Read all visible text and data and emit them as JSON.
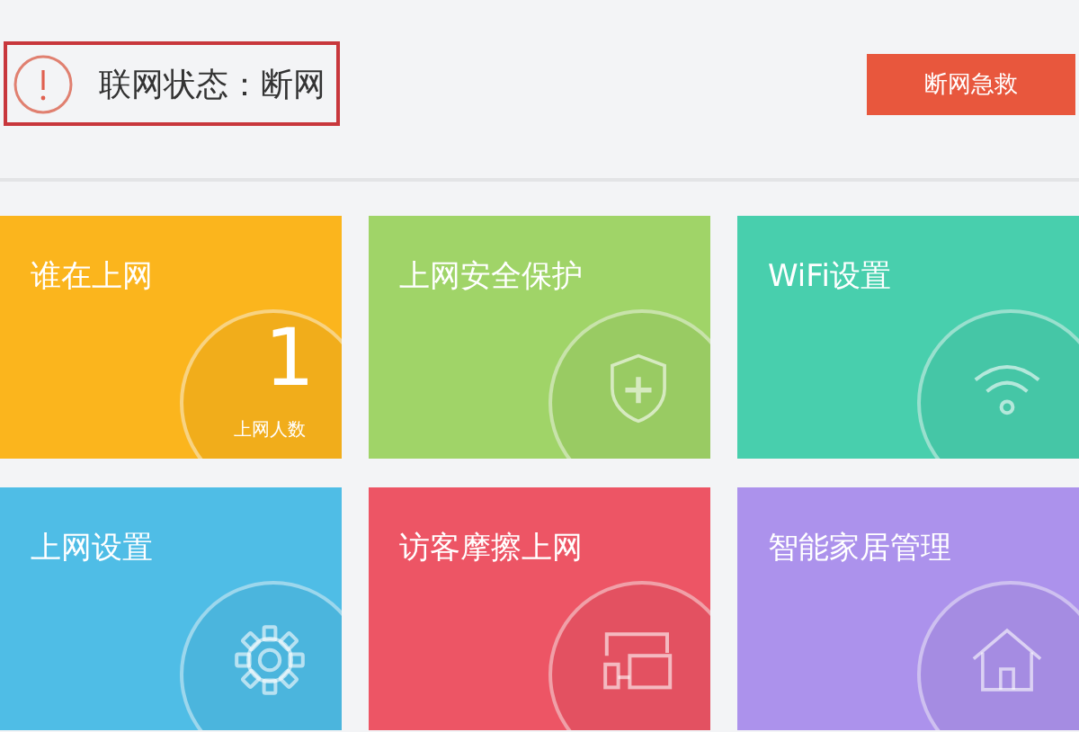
{
  "status": {
    "label": "联网状态：断网"
  },
  "rescue_button": {
    "label": "断网急救"
  },
  "tiles": [
    {
      "kind": "count",
      "title": "谁在上网",
      "color": "#fbb51d",
      "count": "1",
      "count_label": "上网人数"
    },
    {
      "kind": "shield",
      "title": "上网安全保护",
      "color": "#a0d468"
    },
    {
      "kind": "wifi",
      "title": "WiFi设置",
      "color": "#48cfad"
    },
    {
      "kind": "gear",
      "title": "上网设置",
      "color": "#4fbde6"
    },
    {
      "kind": "devices",
      "title": "访客摩擦上网",
      "color": "#ed5565"
    },
    {
      "kind": "house",
      "title": "智能家居管理",
      "color": "#ac92ec"
    }
  ]
}
